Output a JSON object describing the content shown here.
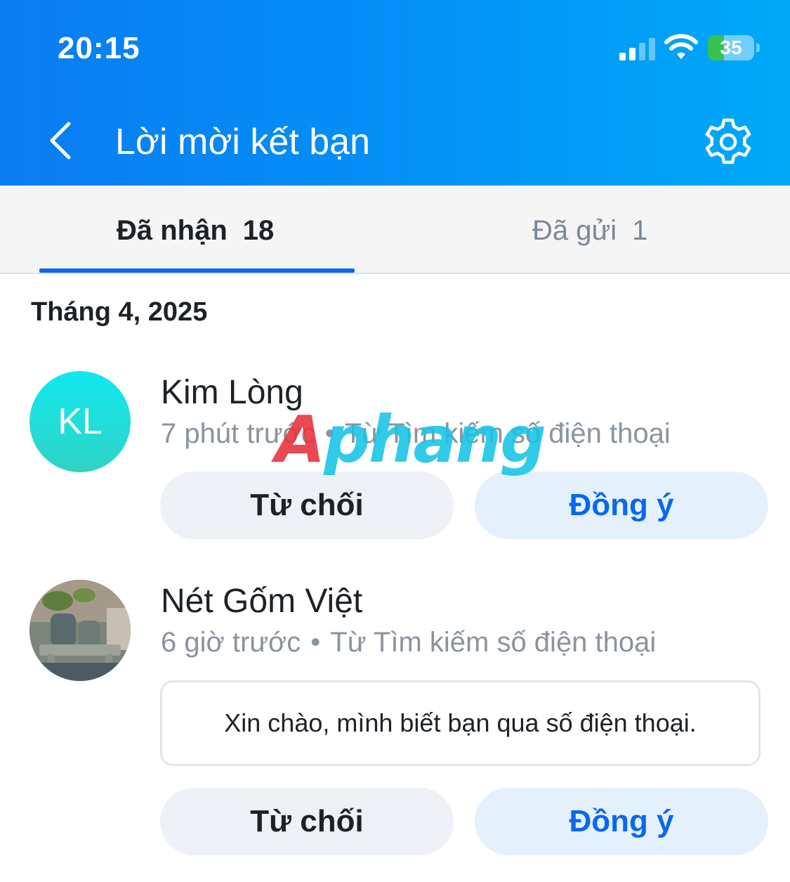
{
  "status_bar": {
    "time": "20:15",
    "battery": "35"
  },
  "header": {
    "title": "Lời mời kết bạn"
  },
  "tabs": [
    {
      "label": "Đã nhận",
      "count": "18",
      "active": true
    },
    {
      "label": "Đã gửi",
      "count": "1",
      "active": false
    }
  ],
  "section": {
    "title": "Tháng 4, 2025"
  },
  "requests": [
    {
      "name": "Kim Lòng",
      "avatar_initials": "KL",
      "time": "7 phút trước",
      "separator": "•",
      "source": "Từ Tìm kiếm số điện thoại",
      "decline_label": "Từ chối",
      "accept_label": "Đồng ý"
    },
    {
      "name": "Nét Gốm Việt",
      "time": "6 giờ trước",
      "separator": "•",
      "source": "Từ Tìm kiếm số điện thoại",
      "message": "Xin chào, mình biết bạn qua số điện thoại.",
      "decline_label": "Từ chối",
      "accept_label": "Đồng ý"
    }
  ],
  "watermark": {
    "first": "A",
    "rest": "phang"
  },
  "colors": {
    "header_start": "#0a7cf2",
    "header_end": "#00a9f8",
    "accent": "#0a68ef",
    "accept_bg": "#e4f1fd",
    "decline_bg": "#eef1f5"
  }
}
